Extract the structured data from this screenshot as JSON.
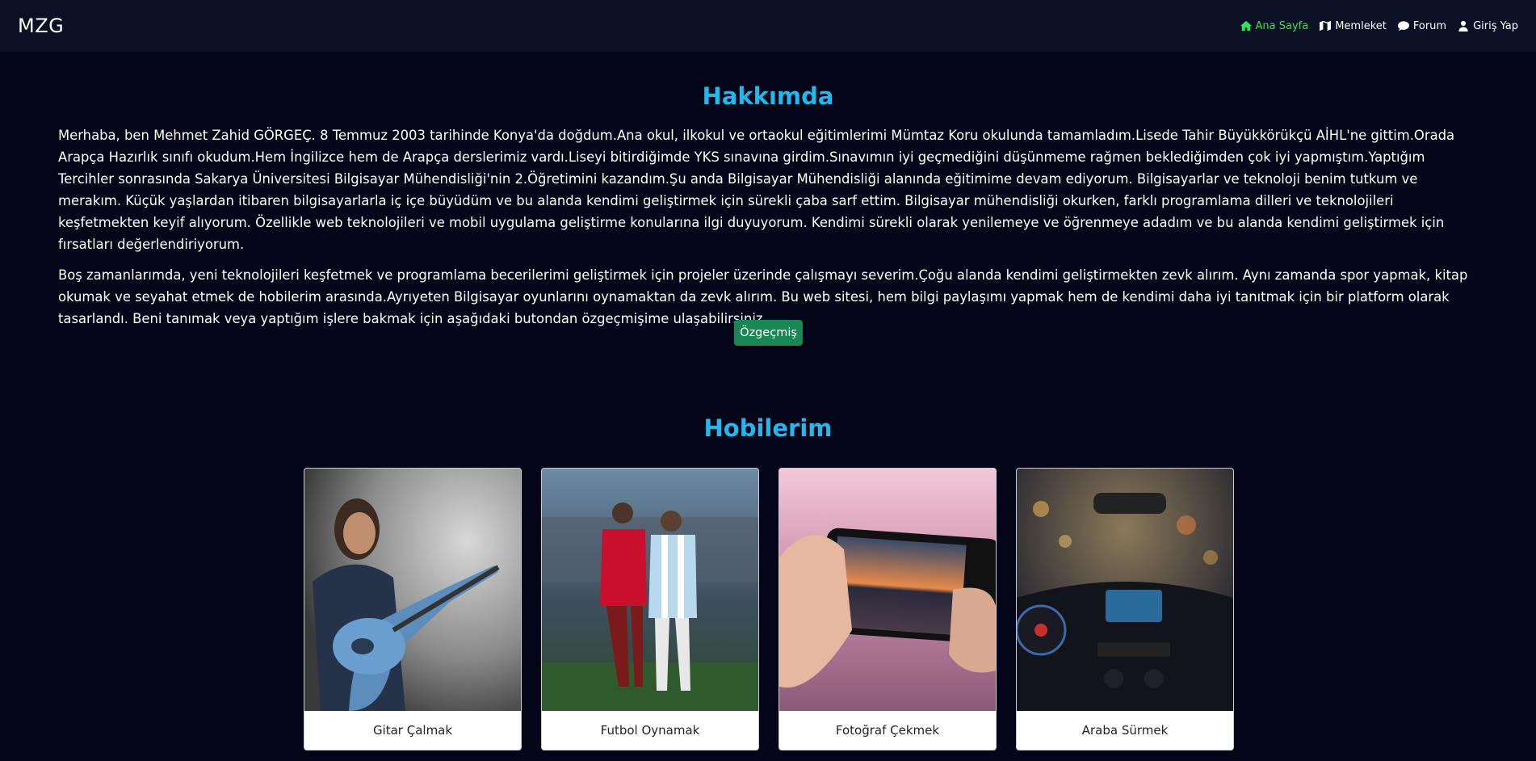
{
  "navbar": {
    "brand": "MZG",
    "items": [
      {
        "label": "Ana Sayfa",
        "icon": "home-icon",
        "active": true
      },
      {
        "label": "Memleket",
        "icon": "map-icon",
        "active": false
      },
      {
        "label": "Forum",
        "icon": "comment-icon",
        "active": false
      },
      {
        "label": "Giriş Yap",
        "icon": "user-icon",
        "active": false
      }
    ],
    "active_color": "#2ee35c"
  },
  "about": {
    "title": "Hakkımda",
    "paragraphs": [
      "Merhaba, ben Mehmet Zahid GÖRGEÇ. 8 Temmuz 2003 tarihinde Konya'da doğdum.Ana okul, ilkokul ve ortaokul eğitimlerimi Mümtaz Koru okulunda tamamladım.Lisede Tahir Büyükkörükçü AİHL'ne gittim.Orada Arapça Hazırlık sınıfı okudum.Hem İngilizce hem de Arapça derslerimiz vardı.Liseyi bitirdiğimde YKS sınavına girdim.Sınavımın iyi geçmediğini düşünmeme rağmen beklediğimden çok iyi yapmıştım.Yaptığım Tercihler sonrasında Sakarya Üniversitesi Bilgisayar Mühendisliği'nin 2.Öğretimini kazandım.Şu anda Bilgisayar Mühendisliği alanında eğitimime devam ediyorum. Bilgisayarlar ve teknoloji benim tutkum ve merakım. Küçük yaşlardan itibaren bilgisayarlarla iç içe büyüdüm ve bu alanda kendimi geliştirmek için sürekli çaba sarf ettim. Bilgisayar mühendisliği okurken, farklı programlama dilleri ve teknolojileri keşfetmekten keyif alıyorum. Özellikle web teknolojileri ve mobil uygulama geliştirme konularına ilgi duyuyorum. Kendimi sürekli olarak yenilemeye ve öğrenmeye adadım ve bu alanda kendimi geliştirmek için fırsatları değerlendiriyorum.",
      "Boş zamanlarımda, yeni teknolojileri keşfetmek ve programlama becerilerimi geliştirmek için projeler üzerinde çalışmayı severim.Çoğu alanda kendimi geliştirmekten zevk alırım. Aynı zamanda spor yapmak, kitap okumak ve seyahat etmek de hobilerim arasında.Ayrıyeten Bilgisayar oyunlarını oynamaktan da zevk alırım. Bu web sitesi, hem bilgi paylaşımı yapmak hem de kendimi daha iyi tanıtmak için bir platform olarak tasarlandı. Beni tanımak veya yaptığım işlere bakmak için aşağıdaki butondan özgeçmişime ulaşabilirsiniz"
    ],
    "cv_button": "Özgeçmiş"
  },
  "hobbies": {
    "title": "Hobilerim",
    "cards": [
      {
        "label": "Gitar Çalmak"
      },
      {
        "label": "Futbol Oynamak"
      },
      {
        "label": "Fotoğraf Çekmek"
      },
      {
        "label": "Araba Sürmek"
      }
    ]
  },
  "colors": {
    "background": "#05051a",
    "navbar": "#0b1124",
    "heading": "#22b8ec",
    "button": "#198754"
  }
}
